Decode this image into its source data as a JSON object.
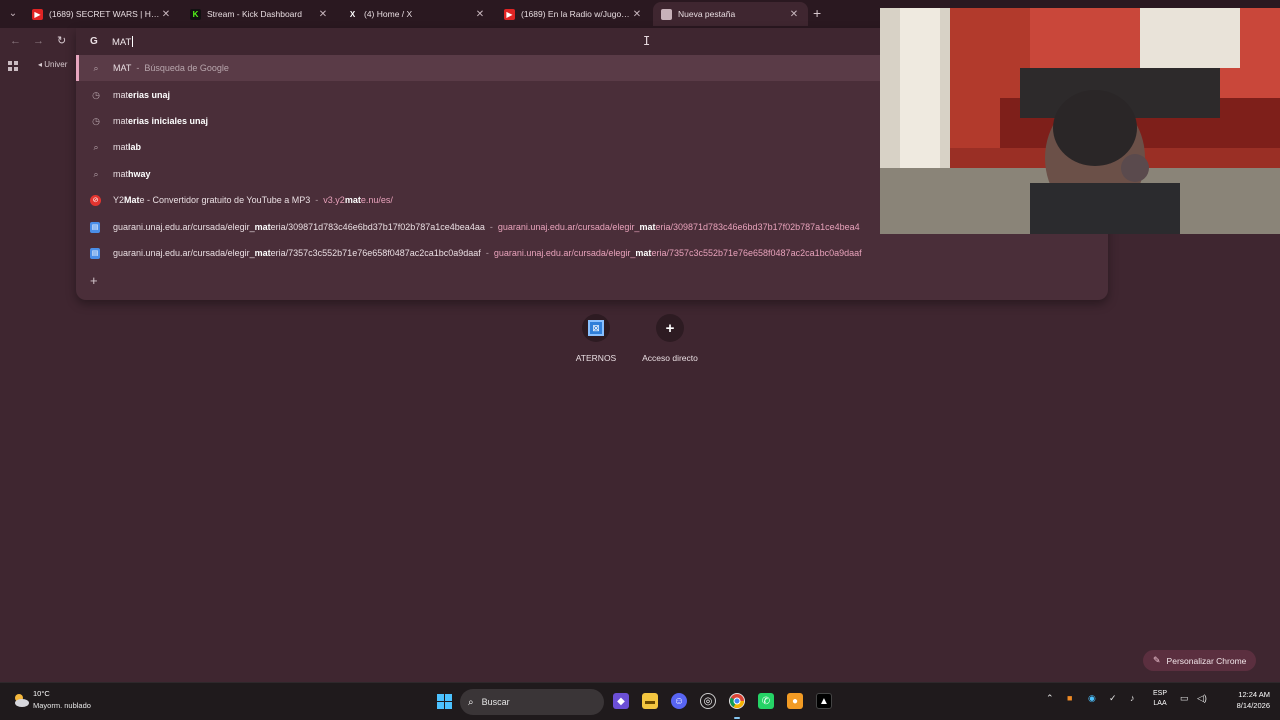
{
  "browser": {
    "tabs": [
      {
        "title": "(1689) SECRET WARS | Historia",
        "favicon": "youtube-icon",
        "active": false
      },
      {
        "title": "Stream - Kick Dashboard",
        "favicon": "kick-icon",
        "active": false
      },
      {
        "title": "(4) Home / X",
        "favicon": "x-icon",
        "active": false
      },
      {
        "title": "(1689) En la Radio w/Jugo! - Yo",
        "favicon": "youtube-icon",
        "active": false
      },
      {
        "title": "Nueva pestaña",
        "favicon": "chrome-icon",
        "active": true
      }
    ],
    "new_tab_glyph": "+",
    "bookmark_label": "Univer"
  },
  "omnibox": {
    "search_engine_glyph": "G",
    "input_value": "MAT",
    "suggestions": [
      {
        "type": "search",
        "icon": "search-icon",
        "pre": "MAT",
        "bold": "",
        "post": "",
        "sep": "-",
        "sub": "Búsqueda de Google",
        "url_pre": "",
        "url_bold": "",
        "url_post": ""
      },
      {
        "type": "history",
        "icon": "history-icon",
        "pre": "mat",
        "bold": "erias unaj",
        "post": "",
        "sep": "",
        "sub": "",
        "url_pre": "",
        "url_bold": "",
        "url_post": ""
      },
      {
        "type": "history",
        "icon": "history-icon",
        "pre": "mat",
        "bold": "erias iniciales unaj",
        "post": "",
        "sep": "",
        "sub": "",
        "url_pre": "",
        "url_bold": "",
        "url_post": ""
      },
      {
        "type": "search",
        "icon": "search-icon",
        "pre": "mat",
        "bold": "lab",
        "post": "",
        "sep": "",
        "sub": "",
        "url_pre": "",
        "url_bold": "",
        "url_post": ""
      },
      {
        "type": "search",
        "icon": "search-icon",
        "pre": "mat",
        "bold": "hway",
        "post": "",
        "sep": "",
        "sub": "",
        "url_pre": "",
        "url_bold": "",
        "url_post": ""
      },
      {
        "type": "site",
        "icon": "y2mate-icon",
        "pre": "Y2",
        "bold": "Mat",
        "post": "e - Convertidor gratuito de YouTube a MP3",
        "sep": "-",
        "sub": "",
        "url_pre": "v3.y2",
        "url_bold": "mat",
        "url_post": "e.nu/es/"
      },
      {
        "type": "site",
        "icon": "page-icon",
        "pre": "guarani.unaj.edu.ar/cursada/elegir_",
        "bold": "mat",
        "post": "eria/309871d783c46e6bd37b17f02b787a1ce4bea4aa",
        "sep": "-",
        "sub": "",
        "url_pre": "guarani.unaj.edu.ar/cursada/elegir_",
        "url_bold": "mat",
        "url_post": "eria/309871d783c46e6bd37b17f02b787a1ce4bea4"
      },
      {
        "type": "site",
        "icon": "page-icon",
        "pre": "guarani.unaj.edu.ar/cursada/elegir_",
        "bold": "mat",
        "post": "eria/7357c3c552b71e76e658f0487ac2ca1bc0a9daaf",
        "sep": "-",
        "sub": "",
        "url_pre": "guarani.unaj.edu.ar/cursada/elegir_",
        "url_bold": "mat",
        "url_post": "eria/7357c3c552b71e76e658f0487ac2ca1bc0a9daaf"
      }
    ]
  },
  "shortcuts": [
    {
      "label": "ATERNOS",
      "icon": "aternos-icon"
    },
    {
      "label": "Acceso directo",
      "icon": "add-icon"
    }
  ],
  "customize_label": "Personalizar Chrome",
  "taskbar": {
    "weather_temp": "10°C",
    "weather_condition": "Mayorm. nublado",
    "search_label": "Buscar",
    "lang_line1": "ESP",
    "lang_line2": "LAA",
    "time": "12:24 AM",
    "date": "8/14/2026"
  },
  "colors": {
    "page_bg": "#3f2630",
    "dropdown_bg": "#4a2e39",
    "selected_row": "#5a3b47",
    "url_accent": "#e8a2bb",
    "taskbar_bg": "#1f1a1c"
  }
}
